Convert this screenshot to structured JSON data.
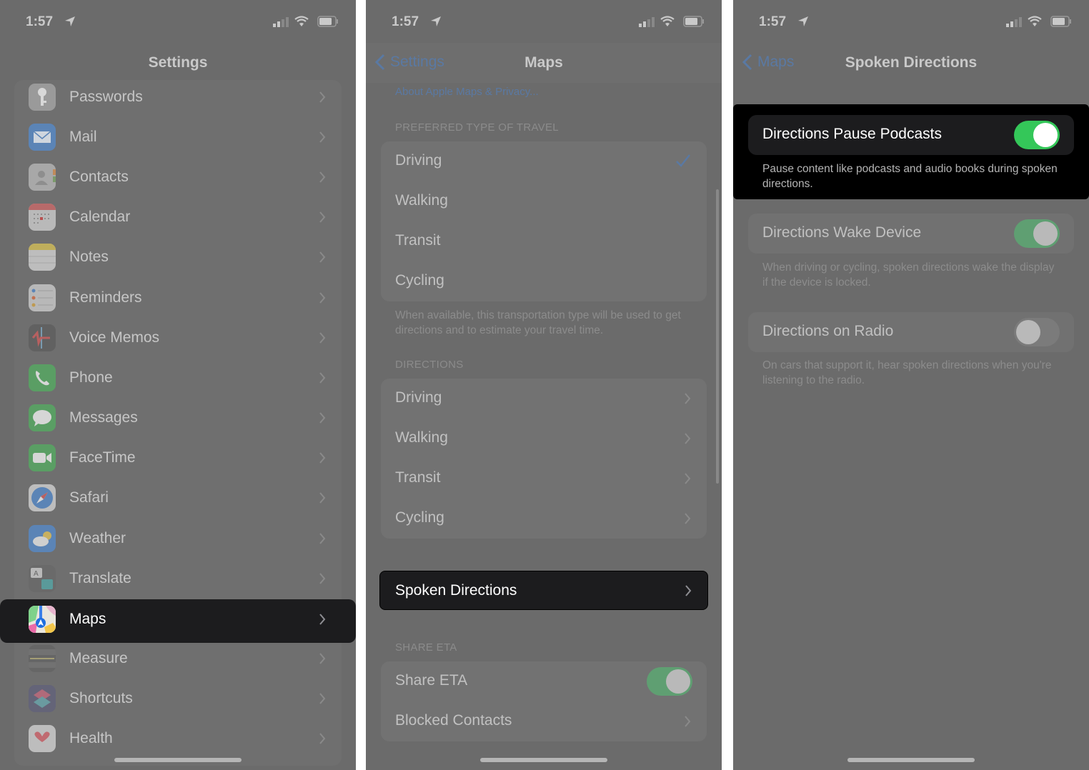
{
  "status_bar": {
    "time": "1:57"
  },
  "panel1": {
    "title": "Settings",
    "items": [
      {
        "label": "Passwords",
        "icon": "key-icon"
      },
      {
        "label": "Mail",
        "icon": "mail-icon"
      },
      {
        "label": "Contacts",
        "icon": "contacts-icon"
      },
      {
        "label": "Calendar",
        "icon": "calendar-icon"
      },
      {
        "label": "Notes",
        "icon": "notes-icon"
      },
      {
        "label": "Reminders",
        "icon": "reminders-icon"
      },
      {
        "label": "Voice Memos",
        "icon": "voice-memos-icon"
      },
      {
        "label": "Phone",
        "icon": "phone-icon"
      },
      {
        "label": "Messages",
        "icon": "messages-icon"
      },
      {
        "label": "FaceTime",
        "icon": "facetime-icon"
      },
      {
        "label": "Safari",
        "icon": "safari-icon"
      },
      {
        "label": "Weather",
        "icon": "weather-icon"
      },
      {
        "label": "Translate",
        "icon": "translate-icon"
      },
      {
        "label": "Maps",
        "icon": "maps-icon",
        "highlighted": true
      },
      {
        "label": "Measure",
        "icon": "measure-icon"
      },
      {
        "label": "Shortcuts",
        "icon": "shortcuts-icon"
      },
      {
        "label": "Health",
        "icon": "health-icon"
      }
    ]
  },
  "panel2": {
    "back_label": "Settings",
    "title": "Maps",
    "privacy_link": "About Apple Maps & Privacy...",
    "preferred_header": "PREFERRED TYPE OF TRAVEL",
    "preferred_options": [
      {
        "label": "Driving",
        "selected": true
      },
      {
        "label": "Walking",
        "selected": false
      },
      {
        "label": "Transit",
        "selected": false
      },
      {
        "label": "Cycling",
        "selected": false
      }
    ],
    "preferred_footer": "When available, this transportation type will be used to get directions and to estimate your travel time.",
    "directions_header": "DIRECTIONS",
    "directions_items": [
      "Driving",
      "Walking",
      "Transit",
      "Cycling"
    ],
    "spoken_directions": "Spoken Directions",
    "share_eta_header": "SHARE ETA",
    "share_eta_label": "Share ETA",
    "share_eta_on": true,
    "blocked_contacts": "Blocked Contacts"
  },
  "panel3": {
    "back_label": "Maps",
    "title": "Spoken Directions",
    "settings": [
      {
        "label": "Directions Pause Podcasts",
        "on": true,
        "description": "Pause content like podcasts and audio books during spoken directions.",
        "highlighted": true
      },
      {
        "label": "Directions Wake Device",
        "on": true,
        "description": "When driving or cycling, spoken directions wake the display if the device is locked."
      },
      {
        "label": "Directions on Radio",
        "on": false,
        "description": "On cars that support it, hear spoken directions when you're listening to the radio."
      }
    ]
  },
  "colors": {
    "toggle_on": "#34c759",
    "toggle_on_dimmed": "#5f9f72",
    "link_blue": "#5a79a3",
    "highlight_bg": "#1c1c1e",
    "dim_overlay_bg": "#6b6b6b"
  }
}
